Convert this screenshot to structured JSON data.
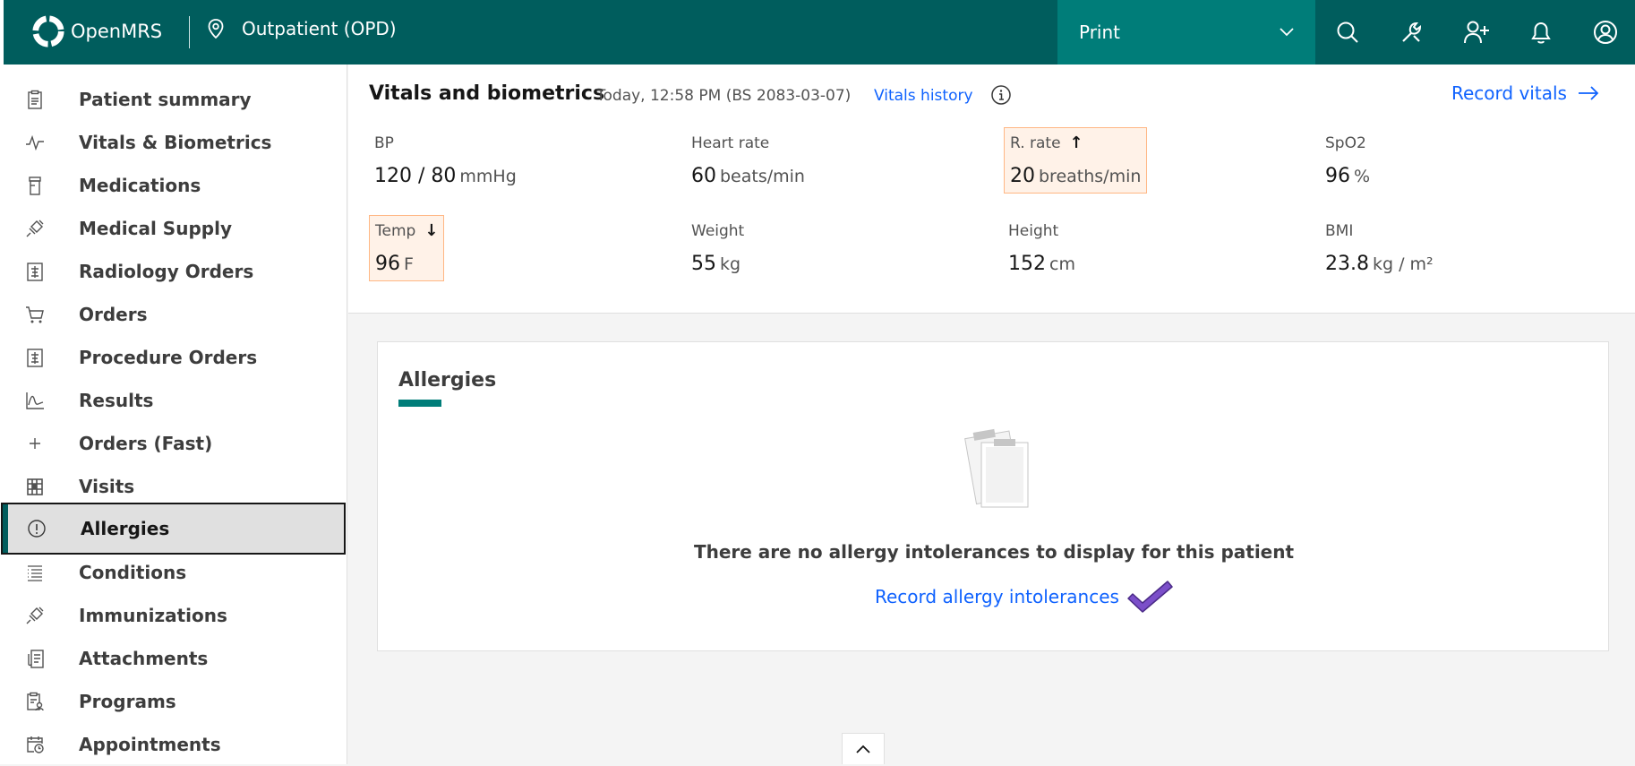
{
  "header": {
    "brand": "OpenMRS",
    "location": "Outpatient (OPD)",
    "print_label": "Print",
    "icons": [
      "search-icon",
      "tools-icon",
      "add-user-icon",
      "bell-icon",
      "user-avatar-icon"
    ]
  },
  "sidebar": {
    "items": [
      {
        "label": "Patient summary",
        "icon": "clipboard-icon"
      },
      {
        "label": "Vitals & Biometrics",
        "icon": "activity-icon"
      },
      {
        "label": "Medications",
        "icon": "pill-bottle-icon"
      },
      {
        "label": "Medical Supply",
        "icon": "syringe-icon"
      },
      {
        "label": "Radiology Orders",
        "icon": "report-icon"
      },
      {
        "label": "Orders",
        "icon": "cart-icon"
      },
      {
        "label": "Procedure Orders",
        "icon": "report-icon"
      },
      {
        "label": "Results",
        "icon": "chart-line-icon"
      },
      {
        "label": "Orders (Fast)",
        "icon": "plus-icon"
      },
      {
        "label": "Visits",
        "icon": "calendar-grid-icon"
      },
      {
        "label": "Allergies",
        "icon": "warning-circle-icon"
      },
      {
        "label": "Conditions",
        "icon": "list-icon"
      },
      {
        "label": "Immunizations",
        "icon": "syringe-icon"
      },
      {
        "label": "Attachments",
        "icon": "document-attachment-icon"
      },
      {
        "label": "Programs",
        "icon": "clipboard-user-icon"
      },
      {
        "label": "Appointments",
        "icon": "calendar-clock-icon"
      }
    ],
    "active": "Allergies"
  },
  "vitals": {
    "title": "Vitals and biometrics",
    "timestamp": "Today, 12:58 PM (BS 2083-03-07)",
    "history_link": "Vitals history",
    "record_label": "Record vitals",
    "items": [
      {
        "label": "BP",
        "value": "120 / 80",
        "unit": "mmHg",
        "flag": ""
      },
      {
        "label": "Heart rate",
        "value": "60",
        "unit": "beats/min",
        "flag": ""
      },
      {
        "label": "R. rate",
        "value": "20",
        "unit": "breaths/min",
        "flag": "↑"
      },
      {
        "label": "SpO2",
        "value": "96",
        "unit": "%",
        "flag": ""
      },
      {
        "label": "Temp",
        "value": "96",
        "unit": "F",
        "flag": "↓"
      },
      {
        "label": "Weight",
        "value": "55",
        "unit": "kg",
        "flag": ""
      },
      {
        "label": "Height",
        "value": "152",
        "unit": "cm",
        "flag": ""
      },
      {
        "label": "BMI",
        "value": "23.8",
        "unit": "kg / m²",
        "flag": ""
      }
    ]
  },
  "allergies": {
    "title": "Allergies",
    "empty_message": "There are no allergy intolerances to display for this patient",
    "record_link": "Record allergy intolerances"
  },
  "colors": {
    "brand": "#005d5d",
    "print_bg": "#007d79",
    "link": "#0f62fe",
    "abnormal_bg": "#fff2e8",
    "abnormal_border": "#ffb784",
    "checkmark": "#7b4fc9"
  }
}
